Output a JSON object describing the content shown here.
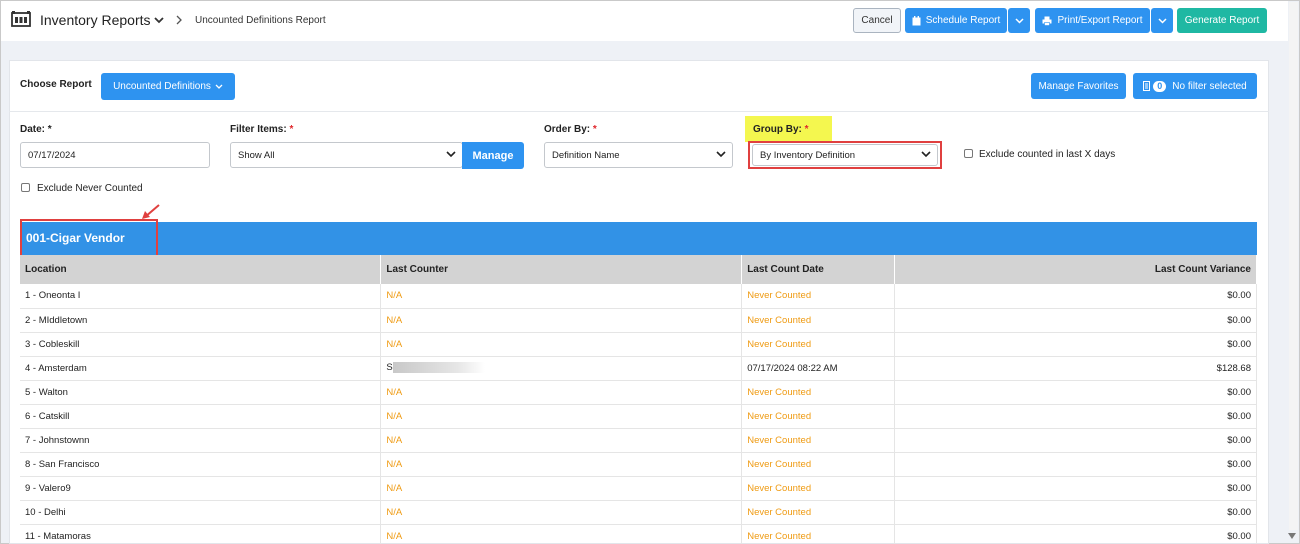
{
  "header": {
    "app_title": "Inventory Reports",
    "breadcrumb": "Uncounted Definitions Report",
    "cancel_label": "Cancel",
    "schedule_label": "Schedule Report",
    "print_label": "Print/Export Report",
    "generate_label": "Generate Report"
  },
  "controls": {
    "choose_report_label": "Choose Report",
    "choose_report_value": "Uncounted Definitions",
    "manage_favorites_label": "Manage Favorites",
    "filter_count": "0",
    "filter_label": "No filter selected",
    "date_label": "Date:",
    "date_value": "07/17/2024",
    "filter_items_label": "Filter Items:",
    "filter_items_value": "Show All",
    "manage_label": "Manage",
    "order_by_label": "Order By:",
    "order_by_value": "Definition Name",
    "group_by_label": "Group By:",
    "group_by_value": "By Inventory Definition",
    "exclude_counted_label": "Exclude counted in last X days",
    "exclude_never_label": "Exclude Never Counted",
    "required_mark": "*"
  },
  "report": {
    "group_title": "001-Cigar Vendor",
    "columns": [
      "Location",
      "Last Counter",
      "Last Count Date",
      "Last Count Variance"
    ],
    "rows": [
      {
        "location": "1 - Oneonta I",
        "counter": "N/A",
        "date": "Never Counted",
        "variance": "$0.00"
      },
      {
        "location": "2 - MIddletown",
        "counter": "N/A",
        "date": "Never Counted",
        "variance": "$0.00"
      },
      {
        "location": "3 - Cobleskill",
        "counter": "N/A",
        "date": "Never Counted",
        "variance": "$0.00"
      },
      {
        "location": "4 - Amsterdam",
        "counter": "S",
        "date": "07/17/2024 08:22 AM",
        "variance": "$128.68"
      },
      {
        "location": "5 - Walton",
        "counter": "N/A",
        "date": "Never Counted",
        "variance": "$0.00"
      },
      {
        "location": "6 - Catskill",
        "counter": "N/A",
        "date": "Never Counted",
        "variance": "$0.00"
      },
      {
        "location": "7 - Johnstownn",
        "counter": "N/A",
        "date": "Never Counted",
        "variance": "$0.00"
      },
      {
        "location": "8 - San Francisco",
        "counter": "N/A",
        "date": "Never Counted",
        "variance": "$0.00"
      },
      {
        "location": "9 - Valero9",
        "counter": "N/A",
        "date": "Never Counted",
        "variance": "$0.00"
      },
      {
        "location": "10 - Delhi",
        "counter": "N/A",
        "date": "Never Counted",
        "variance": "$0.00"
      },
      {
        "location": "11 - Matamoras",
        "counter": "N/A",
        "date": "Never Counted",
        "variance": "$0.00"
      }
    ]
  },
  "colors": {
    "primary": "#2e93f0",
    "teal": "#1fb8a3",
    "orange": "#ef9b13",
    "highlight": "#f4f74f",
    "annotation_red": "#e0403f"
  }
}
